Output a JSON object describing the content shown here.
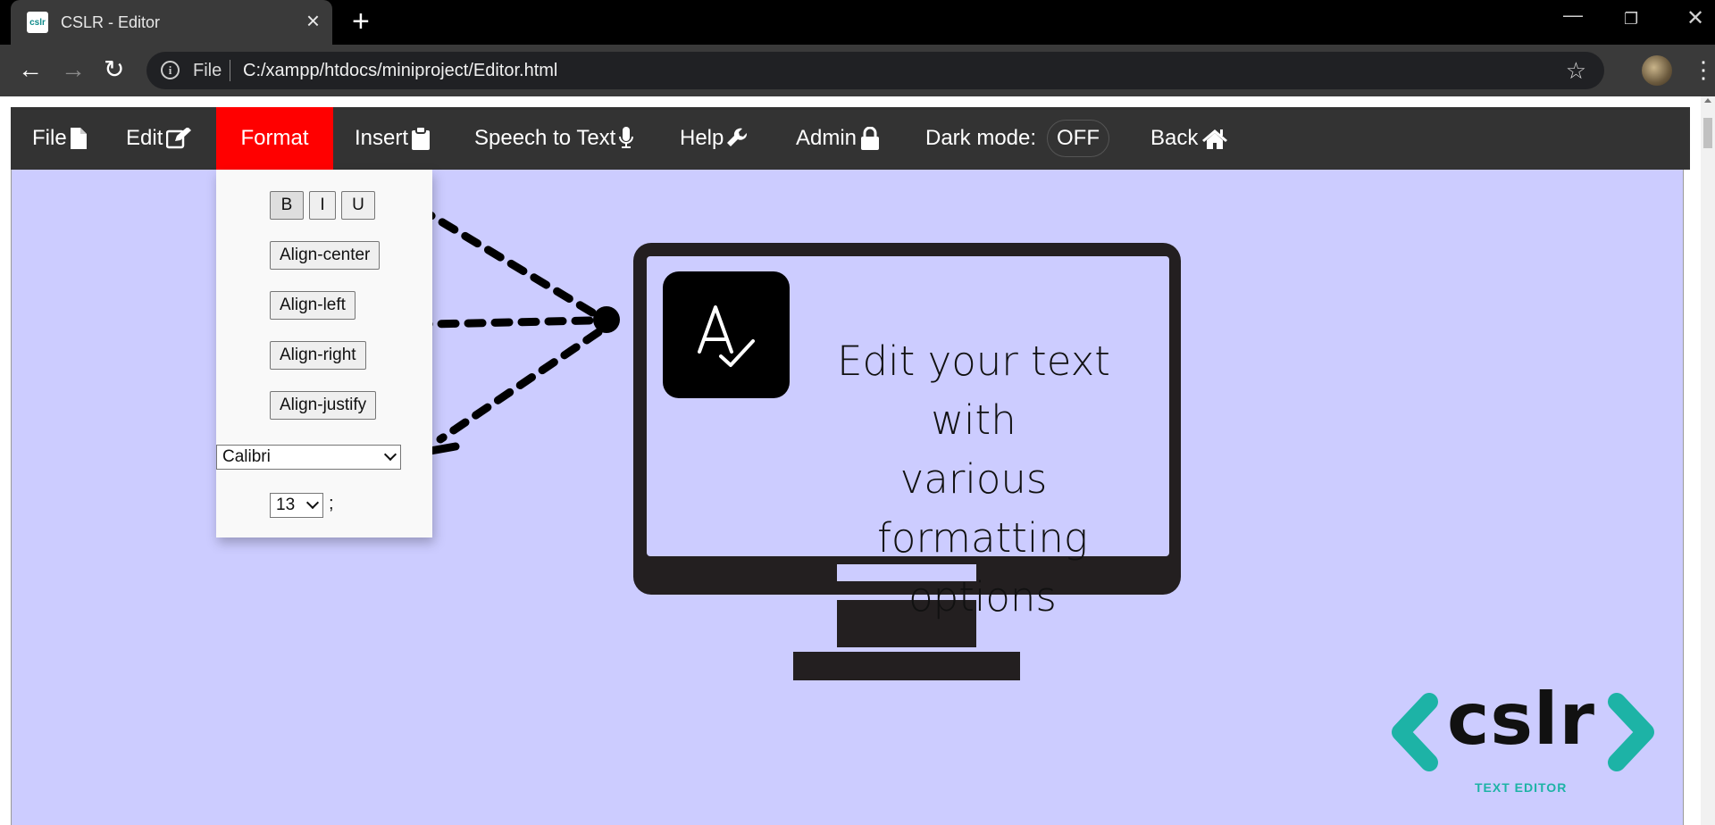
{
  "browser": {
    "tab_title": "CSLR - Editor",
    "favicon_text": "cslr",
    "url_scheme": "File",
    "url": "C:/xampp/htdocs/miniproject/Editor.html"
  },
  "menu": {
    "file": "File",
    "edit": "Edit",
    "format": "Format",
    "insert": "Insert",
    "speech": "Speech to Text",
    "help": "Help",
    "admin": "Admin",
    "dark_mode_label": "Dark mode:",
    "dark_mode_value": "OFF",
    "back": "Back"
  },
  "format_menu": {
    "bold": "B",
    "italic": "I",
    "underline": "U",
    "align_center": "Align-center",
    "align_left": "Align-left",
    "align_right": "Align-right",
    "align_justify": "Align-justify",
    "font_family": "Calibri",
    "font_size": "13",
    "size_suffix": ";"
  },
  "illustration": {
    "line1": "Edit your text with",
    "line2": "various",
    "line3": "formatting options"
  },
  "logo": {
    "text": "cslr",
    "subtitle": "TEXT EDITOR"
  },
  "colors": {
    "menubar": "#333333",
    "active_menu": "#ff0000",
    "canvas": "#ccccff",
    "logo_accent": "#1db3a6"
  }
}
